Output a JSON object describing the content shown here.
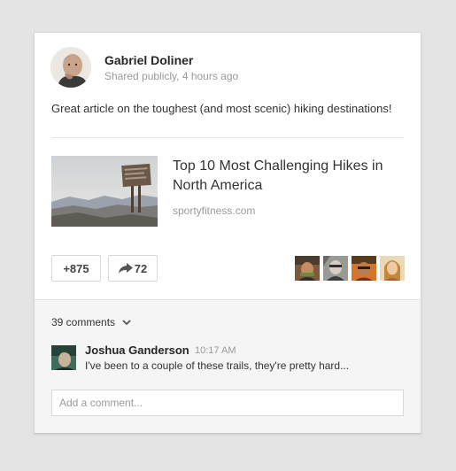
{
  "post": {
    "author_name": "Gabriel Doliner",
    "meta": "Shared publicly, 4 hours ago",
    "text": "Great article on the toughest (and most scenic) hiking destinations!"
  },
  "link": {
    "title": "Top 10 Most Challenging Hikes in North America",
    "domain": "sportyfitness.com"
  },
  "actions": {
    "plus_one_label": "+875",
    "share_count": "72",
    "plus_one_icon": "plus-icon",
    "share_icon": "share-arrow-icon",
    "sharers": [
      "sharer-avatar",
      "sharer-avatar",
      "sharer-avatar",
      "sharer-avatar"
    ]
  },
  "comments": {
    "count_label": "39 comments",
    "toggle_icon": "chevron-down-icon",
    "items": [
      {
        "author": "Joshua Ganderson",
        "time": "10:17 AM",
        "text": "I've been to a couple of these trails, they're pretty hard..."
      }
    ],
    "input_placeholder": "Add a comment..."
  },
  "colors": {
    "page_background": "#e4e4e4",
    "card_background": "#ffffff",
    "comments_background": "#f5f5f5",
    "muted_text": "#9a9a9a",
    "body_text": "#333333"
  }
}
